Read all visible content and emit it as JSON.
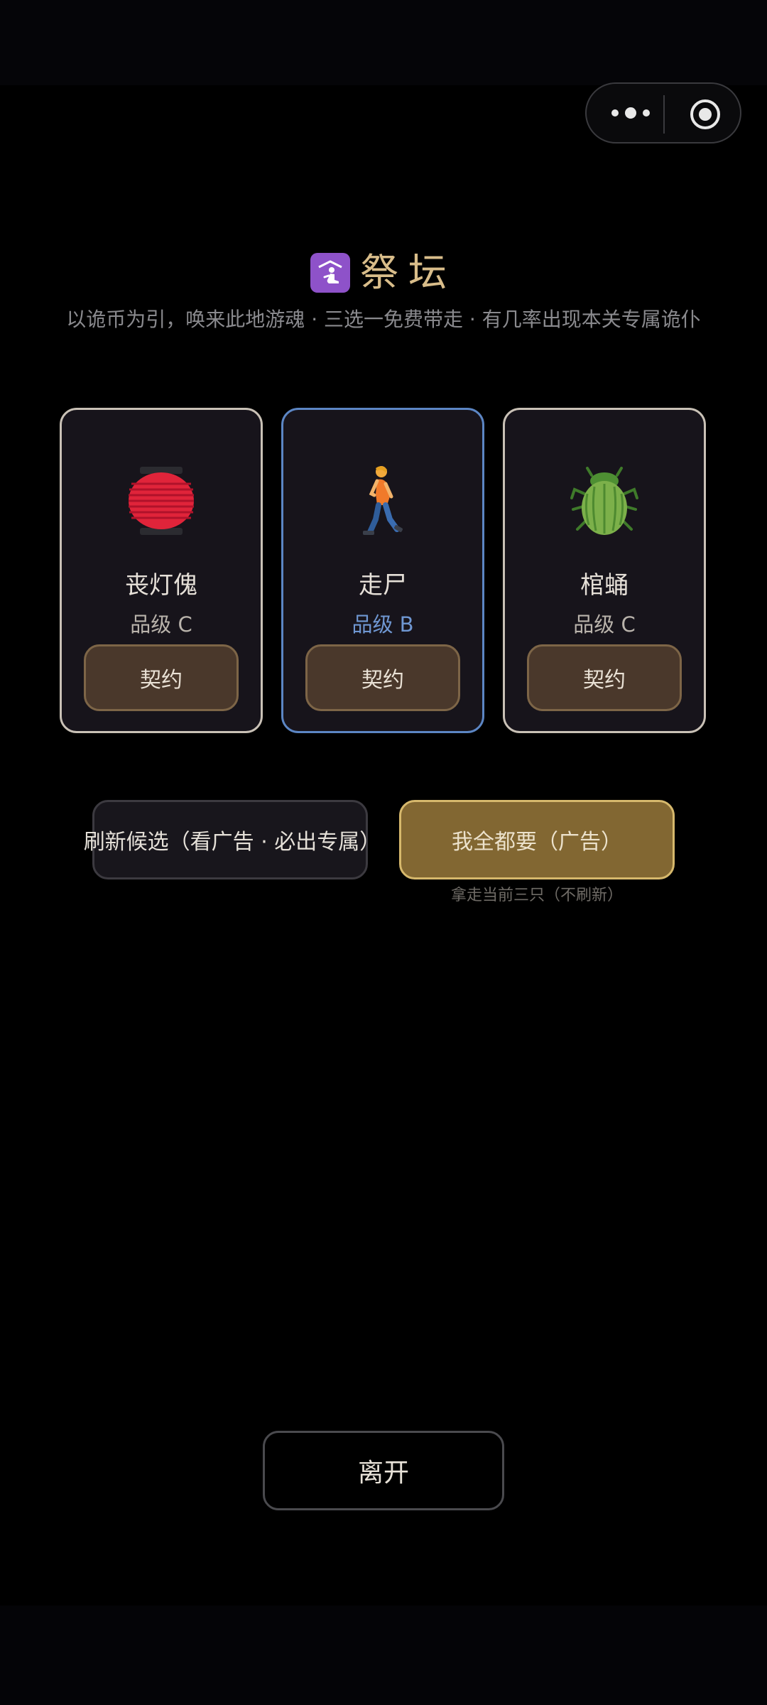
{
  "capsule": {
    "more_icon": "more-dots-icon",
    "close_icon": "target-circle-icon"
  },
  "header": {
    "title_icon": "kneeling-worship-icon",
    "title": "祭坛",
    "subtitle": "以诡币为引，唤来此地游魂 · 三选一免费带走 · 有几率出现本关专属诡仆"
  },
  "cards": [
    {
      "name": "丧灯傀",
      "grade": "品级 C",
      "action": "契约",
      "icon": "red-lantern-icon",
      "selected": false
    },
    {
      "name": "走尸",
      "grade": "品级 B",
      "action": "契约",
      "icon": "walking-person-icon",
      "selected": true
    },
    {
      "name": "棺蛹",
      "grade": "品级 C",
      "action": "契约",
      "icon": "green-beetle-icon",
      "selected": false
    }
  ],
  "actions": {
    "refresh": "刷新候选（看广告 · 必出专属）",
    "take_all": "我全都要（广告）",
    "take_all_note": "拿走当前三只（不刷新）"
  },
  "footer": {
    "leave": "离开"
  },
  "colors": {
    "title_gold": "#d9bd8a",
    "card_border": "#c9c1b6",
    "selected_border": "#5c86c4",
    "grade_b_blue": "#6f97d2",
    "contract_bg": "#4a382b",
    "take_all_bg": "#826732",
    "take_all_border": "#d6b86c"
  }
}
